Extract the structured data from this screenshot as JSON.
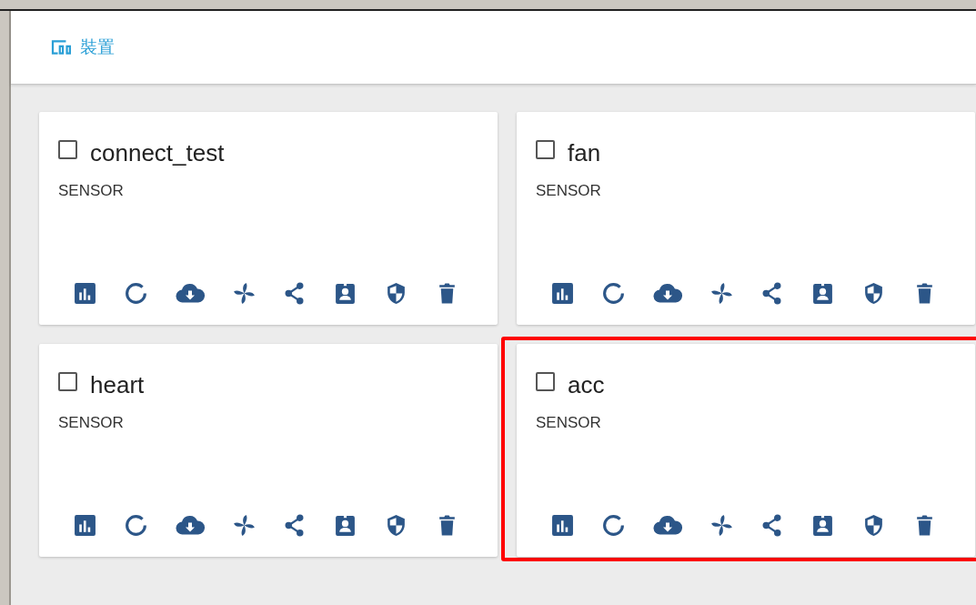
{
  "header": {
    "title": "裝置"
  },
  "devices": [
    {
      "name": "connect_test",
      "type": "SENSOR",
      "checked": false,
      "highlighted": false
    },
    {
      "name": "fan",
      "type": "SENSOR",
      "checked": false,
      "highlighted": false
    },
    {
      "name": "heart",
      "type": "SENSOR",
      "checked": false,
      "highlighted": false
    },
    {
      "name": "acc",
      "type": "SENSOR",
      "checked": false,
      "highlighted": true
    }
  ]
}
